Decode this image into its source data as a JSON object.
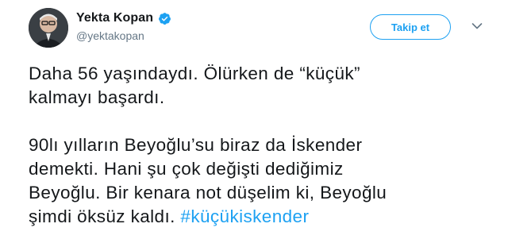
{
  "author": {
    "display_name": "Yekta Kopan",
    "handle": "@yektakopan",
    "verified": true,
    "avatar_icon": "avatar-photo"
  },
  "actions": {
    "follow_label": "Takip et",
    "menu_icon": "chevron-down-icon"
  },
  "tweet": {
    "paragraph1": {
      "line1": "Daha 56 yaşındaydı. Ölürken de “küçük”",
      "line2": "kalmayı başardı."
    },
    "paragraph2": {
      "line1": "90lı yılların Beyoğlu’su biraz da İskender",
      "line2": "demekti. Hani şu çok değişti dediğimiz",
      "line3": "Beyoğlu. Bir kenara not düşelim ki, Beyoğlu",
      "line4_text": "şimdi öksüz kaldı. ",
      "hashtag": "#küçükiskender"
    }
  },
  "colors": {
    "accent": "#1da1f2",
    "text": "#14171a",
    "secondary_text": "#657786"
  }
}
